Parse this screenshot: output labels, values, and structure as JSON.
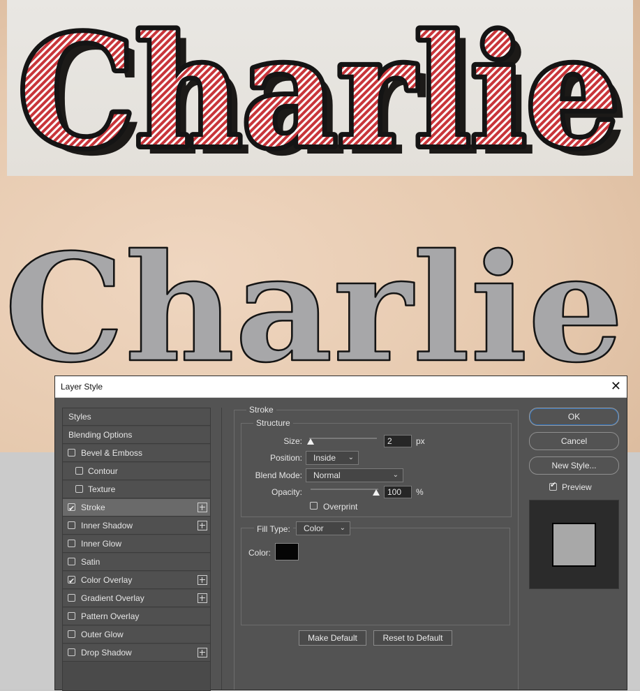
{
  "artwork": {
    "word_top": "Charlie",
    "word_bottom": "Charlie",
    "colors": {
      "top_fill": "#c8353a",
      "top_shadow": "#1c1a18",
      "bottom_fill": "#a7a7a9",
      "stroke": "#141414"
    }
  },
  "dialog": {
    "title": "Layer Style",
    "close_symbol": "✕",
    "styles_list": [
      {
        "label": "Styles",
        "checkbox": false,
        "checked": false,
        "plus": false,
        "indent": false,
        "selected": false
      },
      {
        "label": "Blending Options",
        "checkbox": false,
        "checked": false,
        "plus": false,
        "indent": false,
        "selected": false
      },
      {
        "label": "Bevel & Emboss",
        "checkbox": true,
        "checked": false,
        "plus": false,
        "indent": false,
        "selected": false
      },
      {
        "label": "Contour",
        "checkbox": true,
        "checked": false,
        "plus": false,
        "indent": true,
        "selected": false
      },
      {
        "label": "Texture",
        "checkbox": true,
        "checked": false,
        "plus": false,
        "indent": true,
        "selected": false
      },
      {
        "label": "Stroke",
        "checkbox": true,
        "checked": true,
        "plus": true,
        "indent": false,
        "selected": true
      },
      {
        "label": "Inner Shadow",
        "checkbox": true,
        "checked": false,
        "plus": true,
        "indent": false,
        "selected": false
      },
      {
        "label": "Inner Glow",
        "checkbox": true,
        "checked": false,
        "plus": false,
        "indent": false,
        "selected": false
      },
      {
        "label": "Satin",
        "checkbox": true,
        "checked": false,
        "plus": false,
        "indent": false,
        "selected": false
      },
      {
        "label": "Color Overlay",
        "checkbox": true,
        "checked": true,
        "plus": true,
        "indent": false,
        "selected": false
      },
      {
        "label": "Gradient Overlay",
        "checkbox": true,
        "checked": false,
        "plus": true,
        "indent": false,
        "selected": false
      },
      {
        "label": "Pattern Overlay",
        "checkbox": true,
        "checked": false,
        "plus": false,
        "indent": false,
        "selected": false
      },
      {
        "label": "Outer Glow",
        "checkbox": true,
        "checked": false,
        "plus": false,
        "indent": false,
        "selected": false
      },
      {
        "label": "Drop Shadow",
        "checkbox": true,
        "checked": false,
        "plus": true,
        "indent": false,
        "selected": false
      }
    ],
    "stroke": {
      "section_title": "Stroke",
      "structure_title": "Structure",
      "size_label": "Size:",
      "size_value": "2",
      "size_unit": "px",
      "size_fraction": 0.0,
      "position_label": "Position:",
      "position_value": "Inside",
      "blend_label": "Blend Mode:",
      "blend_value": "Normal",
      "opacity_label": "Opacity:",
      "opacity_value": "100",
      "opacity_unit": "%",
      "opacity_fraction": 1.0,
      "overprint_label": "Overprint",
      "overprint_checked": false,
      "fill_type_label": "Fill Type:",
      "fill_type_value": "Color",
      "color_label": "Color:",
      "color_value": "#050505",
      "make_default": "Make Default",
      "reset_default": "Reset to Default"
    },
    "buttons": {
      "ok": "OK",
      "cancel": "Cancel",
      "new_style": "New Style...",
      "preview_label": "Preview",
      "preview_checked": true
    }
  }
}
